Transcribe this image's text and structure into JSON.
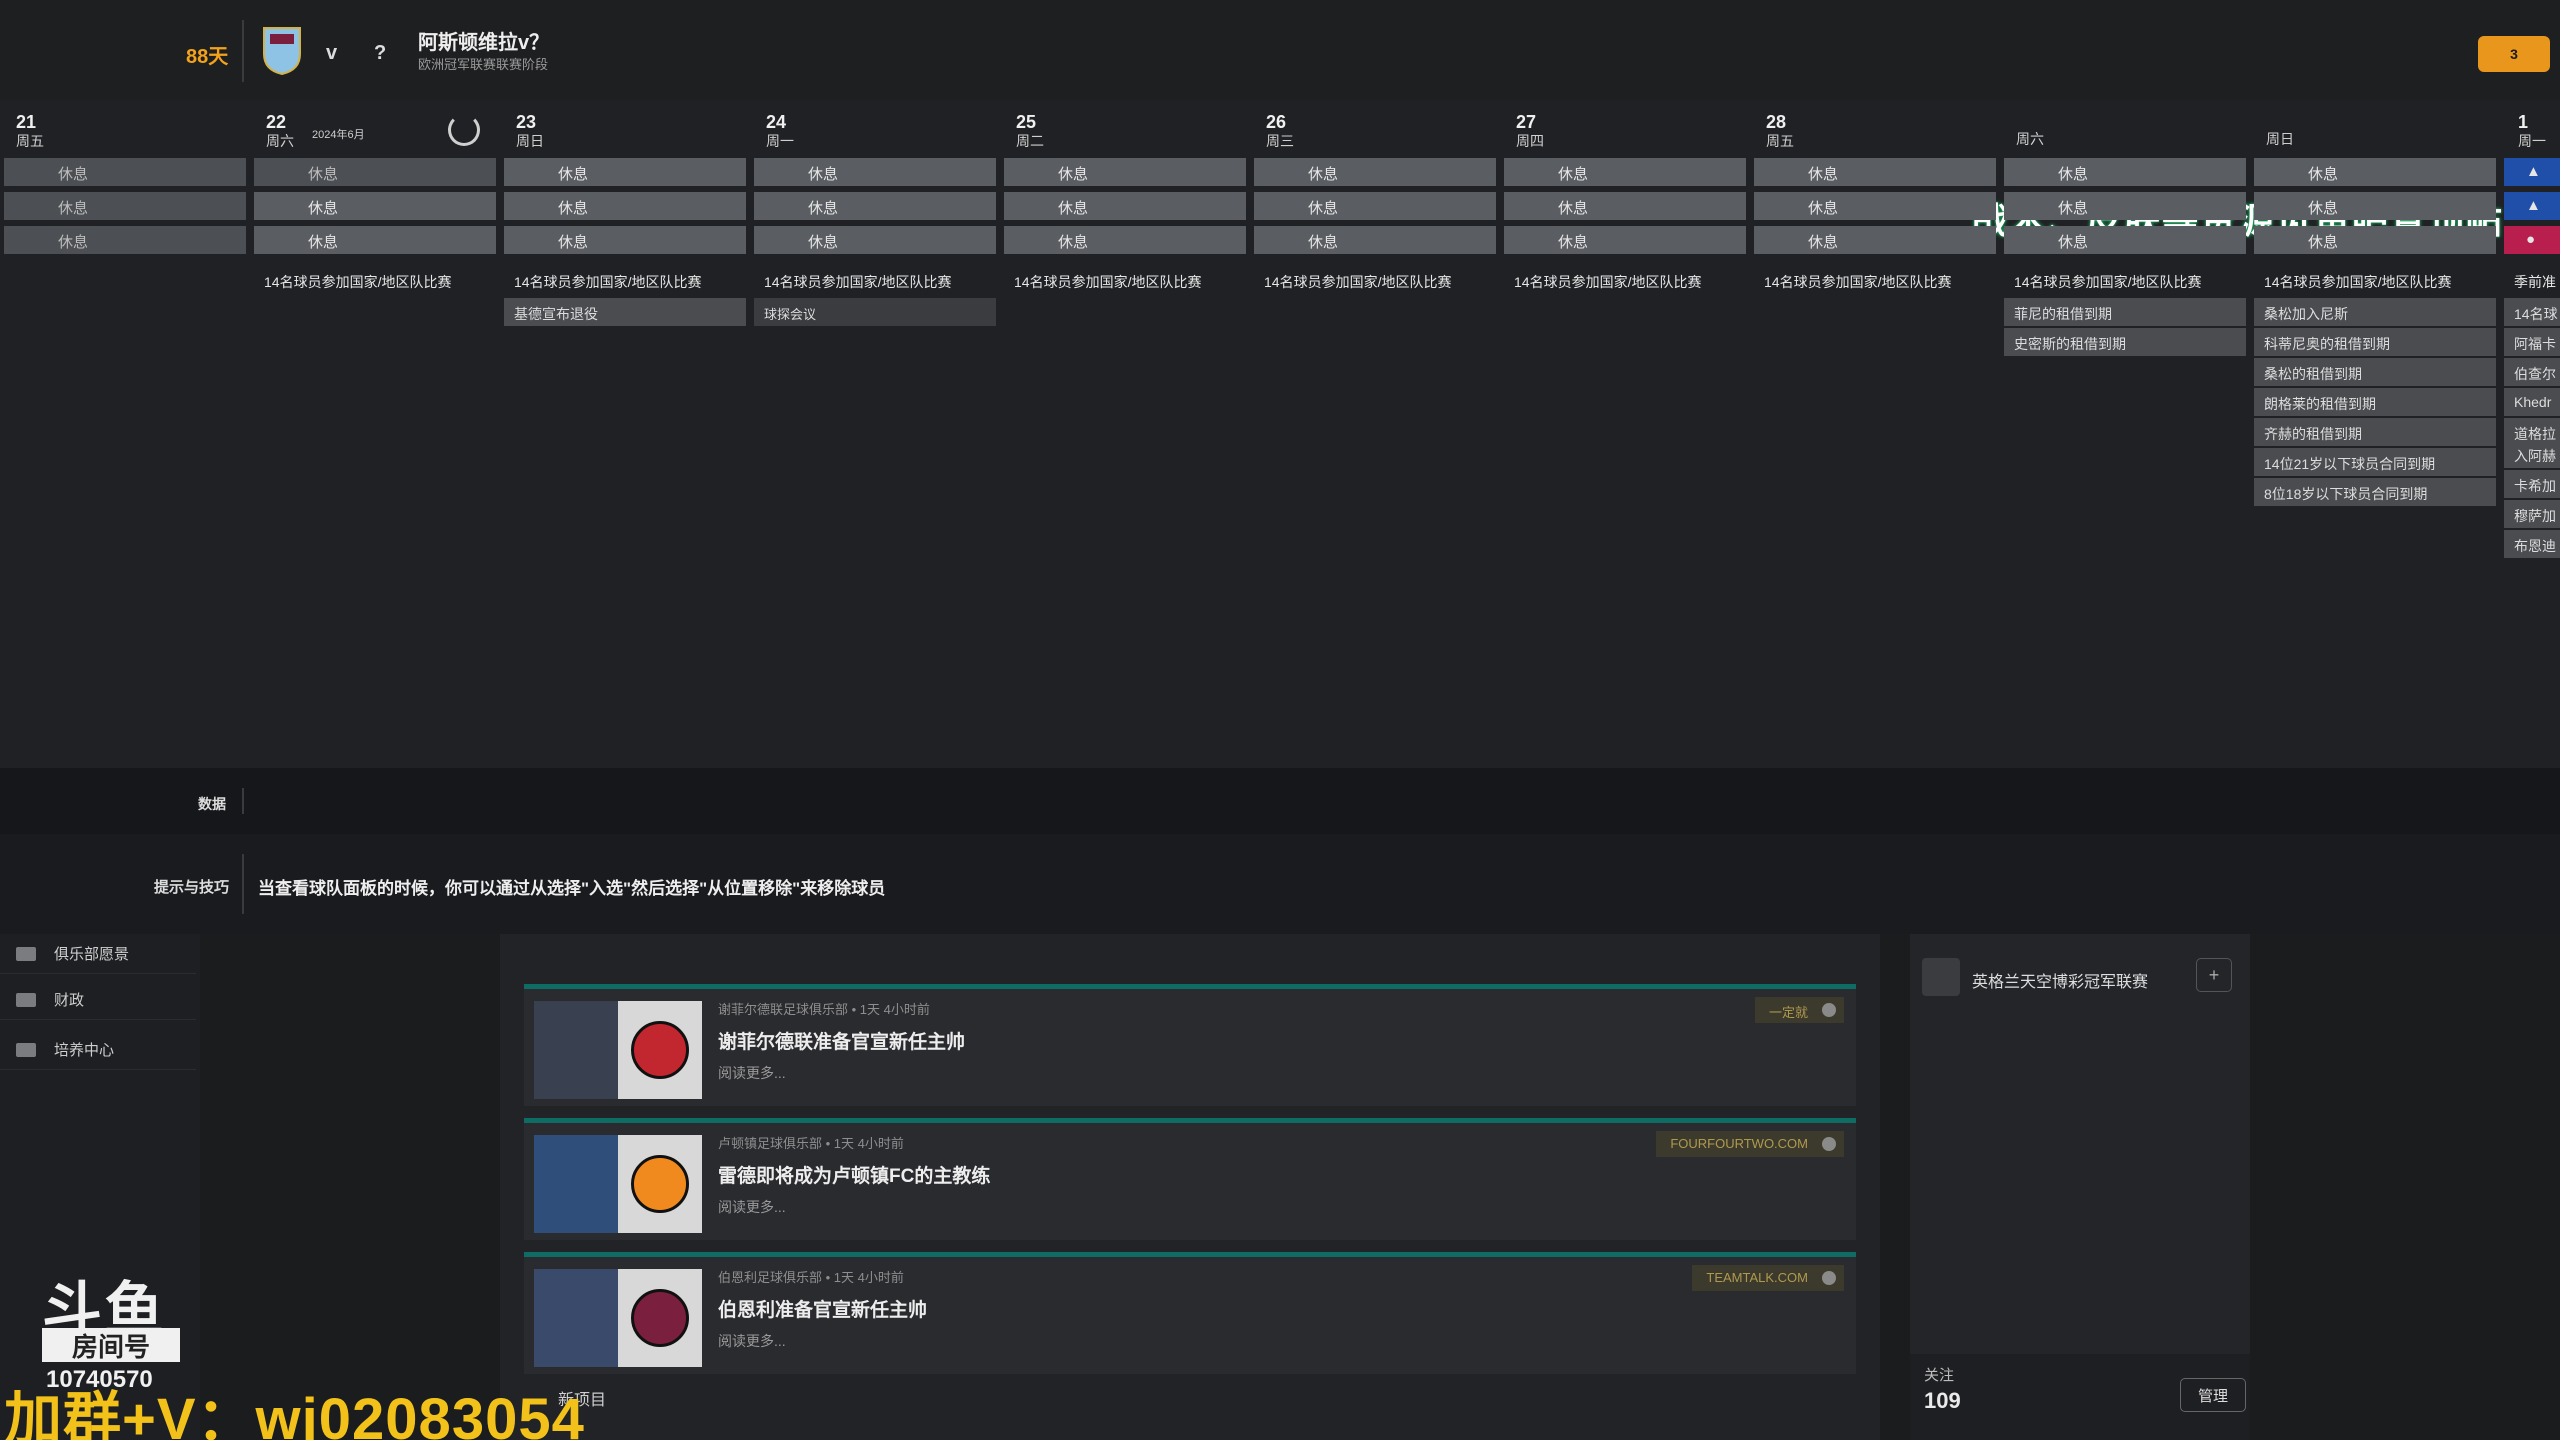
{
  "header": {
    "days_left": "88天",
    "vs": "v",
    "opponent": "?",
    "title": "阿斯顿维拉v？",
    "subtitle": "欧洲冠军联赛联赛阶段",
    "button_label": "3"
  },
  "calendar": {
    "month_label": "2024年6月",
    "days": [
      {
        "num": "21",
        "week": "周五"
      },
      {
        "num": "22",
        "week": "周六"
      },
      {
        "num": "23",
        "week": "周日"
      },
      {
        "num": "24",
        "week": "周一"
      },
      {
        "num": "25",
        "week": "周二"
      },
      {
        "num": "26",
        "week": "周三"
      },
      {
        "num": "27",
        "week": "周四"
      },
      {
        "num": "28",
        "week": "周五"
      },
      {
        "num": "",
        "week": "周六"
      },
      {
        "num": "",
        "week": "周日"
      },
      {
        "num": "1",
        "week": "周一"
      }
    ],
    "rest_label": "休息",
    "national_event": "14名球员参加国家/地区队比赛",
    "col2_event": "基德宣布退役",
    "col3_event": "球探会议",
    "sat_events": [
      "菲尼的租借到期",
      "史密斯的租借到期"
    ],
    "sun_events": [
      "桑松加入尼斯",
      "科蒂尼奥的租借到期",
      "桑松的租借到期",
      "朗格莱的租借到期",
      "齐赫的租借到期",
      "14位21岁以下球员合同到期",
      "8位18岁以下球员合同到期"
    ],
    "mon_events": [
      "季前准",
      "14名球",
      "阿福卡",
      "伯查尔",
      "Khedr",
      "道格拉",
      "入阿赫",
      "卡希加",
      "穆萨加",
      "布恩迪"
    ]
  },
  "overlay_top": "战术、皮肤等资源见鱼吧置顶帖",
  "data_bar": {
    "label": "数据"
  },
  "tips": {
    "label": "提示与技巧",
    "text": "当查看球队面板的时候，你可以通过从选择\"入选\"然后选择\"从位置移除\"来移除球员"
  },
  "sidebar": {
    "items": [
      {
        "label": "俱乐部愿景"
      },
      {
        "label": "财政"
      },
      {
        "label": "培养中心"
      }
    ]
  },
  "news": {
    "items": [
      {
        "meta": "谢菲尔德联足球俱乐部 • 1天 4小时前",
        "title": "谢菲尔德联准备官宣新任主帅",
        "more": "阅读更多...",
        "source": "一定就"
      },
      {
        "meta": "卢顿镇足球俱乐部 • 1天 4小时前",
        "title": "雷德即将成为卢顿镇FC的主教练",
        "more": "阅读更多...",
        "source": "FOURFOURTWO.COM"
      },
      {
        "meta": "伯恩利足球俱乐部 • 1天 4小时前",
        "title": "伯恩利准备官宣新任主帅",
        "more": "阅读更多...",
        "source": "TEAMTALK.COM"
      }
    ],
    "new_items_label": "新项目"
  },
  "right_panel": {
    "league": "英格兰天空博彩冠军联赛",
    "follow_label": "关注",
    "follow_count": "109",
    "manage_label": "管理"
  },
  "stream": {
    "logo_text": "斗鱼",
    "room_label": "房间号",
    "room_number": "10740570",
    "contact": "加群+V：wj02083054"
  }
}
